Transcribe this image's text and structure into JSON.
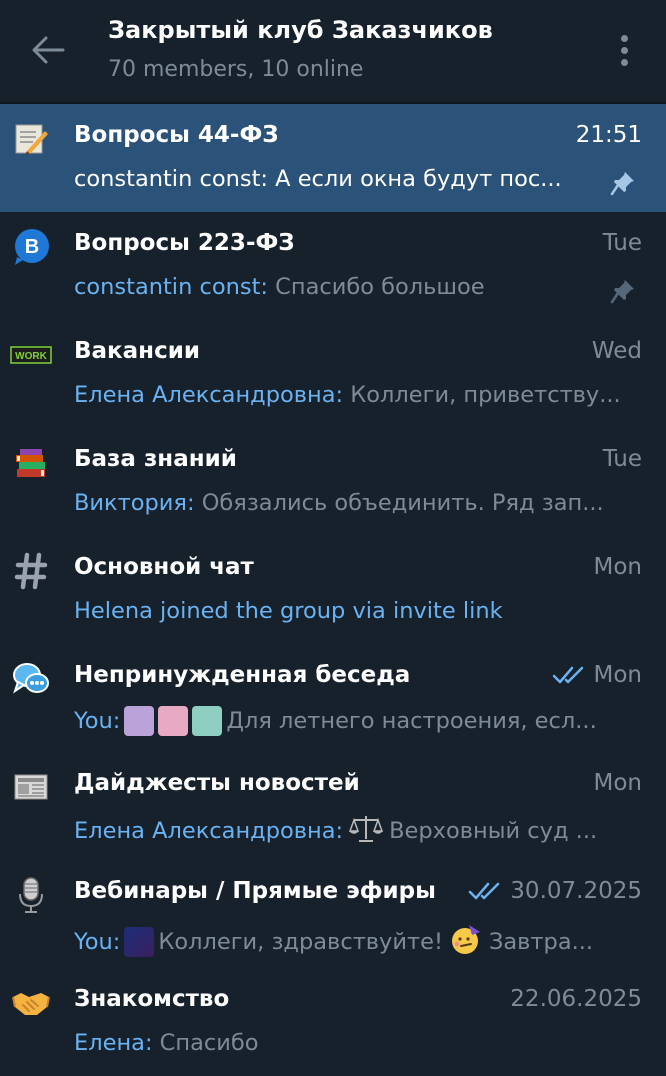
{
  "header": {
    "title": "Закрытый клуб Заказчиков",
    "subtitle": "70 members, 10 online"
  },
  "chats": [
    {
      "name": "Вопросы 44-ФЗ",
      "time": "21:51",
      "sender": "constantin const:",
      "text": " А если окна будут пос...",
      "pinned": true,
      "icon": "memo-icon"
    },
    {
      "name": "Вопросы 223-ФЗ",
      "time": "Tue",
      "sender": "constantin const:",
      "text": " Спасибо большое",
      "pinned": true,
      "icon": "b-badge-icon",
      "icon_letter": "B"
    },
    {
      "name": "Вакансии",
      "time": "Wed",
      "sender": "Елена Александровна:",
      "text": " Коллеги, приветству...",
      "icon": "work-icon",
      "icon_text": "WORK"
    },
    {
      "name": "База знаний",
      "time": "Tue",
      "sender": "Виктория:",
      "text": " Обязались объединить. Ряд зап...",
      "icon": "books-icon"
    },
    {
      "name": "Основной чат",
      "time": "Mon",
      "sender": "",
      "text": "Helena joined the group via invite link",
      "icon": "hash-icon"
    },
    {
      "name": "Непринужденная беседа",
      "time": "Mon",
      "sender": "You:",
      "text": " Для летнего настроения, есл...",
      "read": true,
      "icon": "speech-bubbles-icon"
    },
    {
      "name": "Дайджесты новостей",
      "time": "Mon",
      "sender": "Елена Александровна:",
      "text": " Верховный суд ...",
      "icon": "newspaper-icon"
    },
    {
      "name": "Вебинары / Прямые эфиры",
      "time": "30.07.2025",
      "sender": "You:",
      "text": " Коллеги, здравствуйте!",
      "text2": " Завтра...",
      "read": true,
      "icon": "microphone-icon"
    },
    {
      "name": "Знакомство",
      "time": "22.06.2025",
      "sender": "Елена:",
      "text": " Спасибо",
      "icon": "handshake-icon"
    }
  ],
  "colors": {
    "background": "#17212b",
    "active_row": "#2b5278",
    "accent_link": "#6ab2f2",
    "muted": "#7d8b99"
  }
}
